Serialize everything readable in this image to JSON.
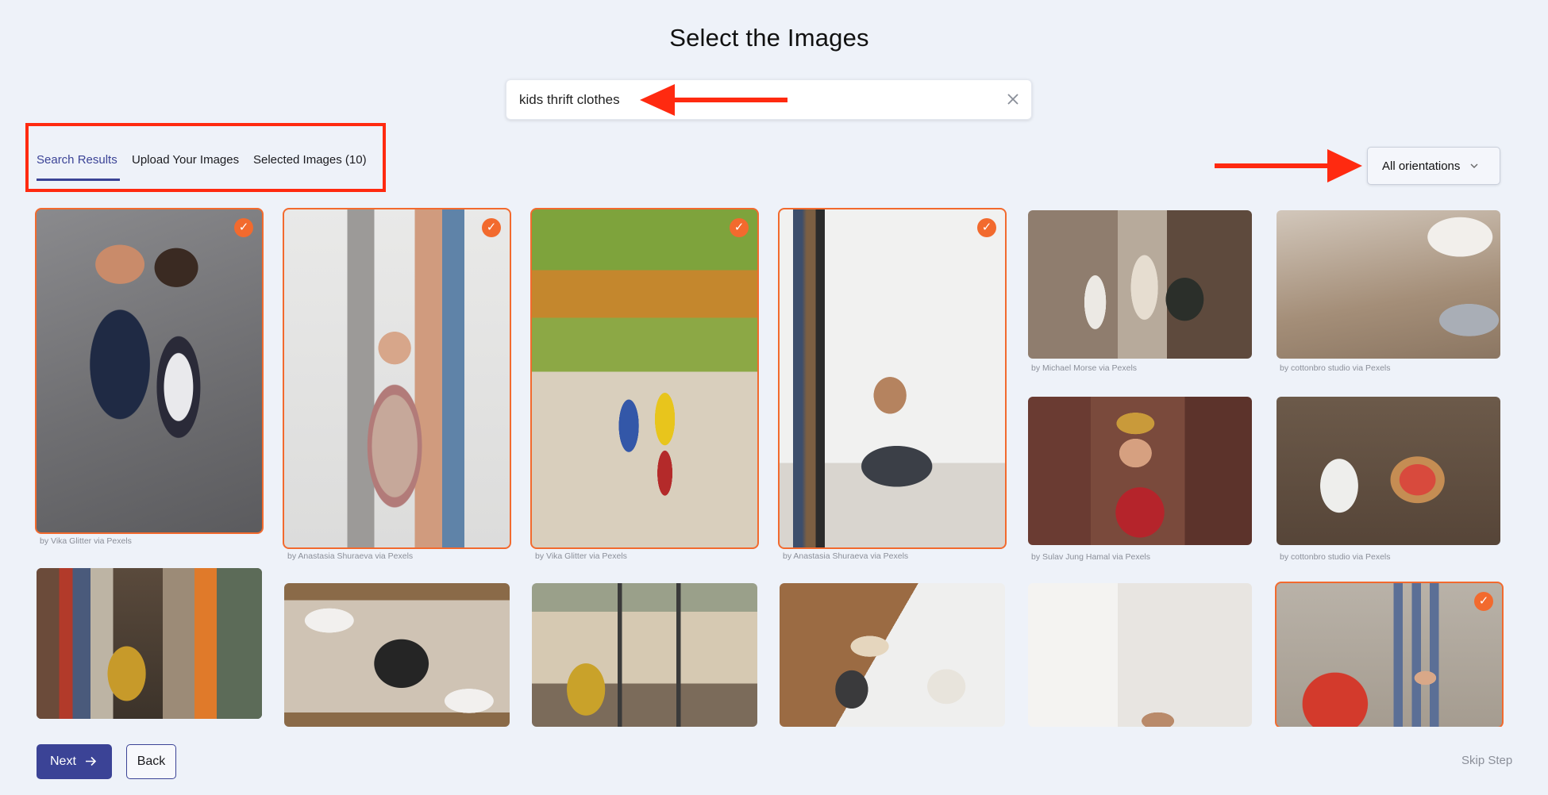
{
  "page": {
    "title": "Select the Images"
  },
  "search": {
    "value": "kids thrift clothes"
  },
  "tabs": [
    {
      "label": "Search Results",
      "active": true
    },
    {
      "label": "Upload Your Images",
      "active": false
    },
    {
      "label": "Selected Images (10)",
      "active": false
    }
  ],
  "filter": {
    "orientation_label": "All orientations"
  },
  "colors": {
    "accent": "#3b4396",
    "selected": "#f26a2e",
    "annotation": "#ff2a10"
  },
  "images": [
    {
      "credit": "by Vika Glitter via Pexels",
      "selected": true
    },
    {
      "credit": "by Anastasia Shuraeva via Pexels",
      "selected": true
    },
    {
      "credit": "by Vika Glitter via Pexels",
      "selected": true
    },
    {
      "credit": "by Anastasia Shuraeva via Pexels",
      "selected": true
    },
    {
      "credit": "by Michael Morse via Pexels",
      "selected": false
    },
    {
      "credit": "by cottonbro studio via Pexels",
      "selected": false
    },
    {
      "credit": "by Sulav Jung Hamal via Pexels",
      "selected": false
    },
    {
      "credit": "by cottonbro studio via Pexels",
      "selected": false
    },
    {
      "credit": "",
      "selected": false
    },
    {
      "credit": "",
      "selected": false
    },
    {
      "credit": "",
      "selected": false
    },
    {
      "credit": "",
      "selected": false
    },
    {
      "credit": "",
      "selected": false
    },
    {
      "credit": "",
      "selected": true
    }
  ],
  "footer": {
    "next_label": "Next",
    "back_label": "Back",
    "skip_label": "Skip Step"
  }
}
